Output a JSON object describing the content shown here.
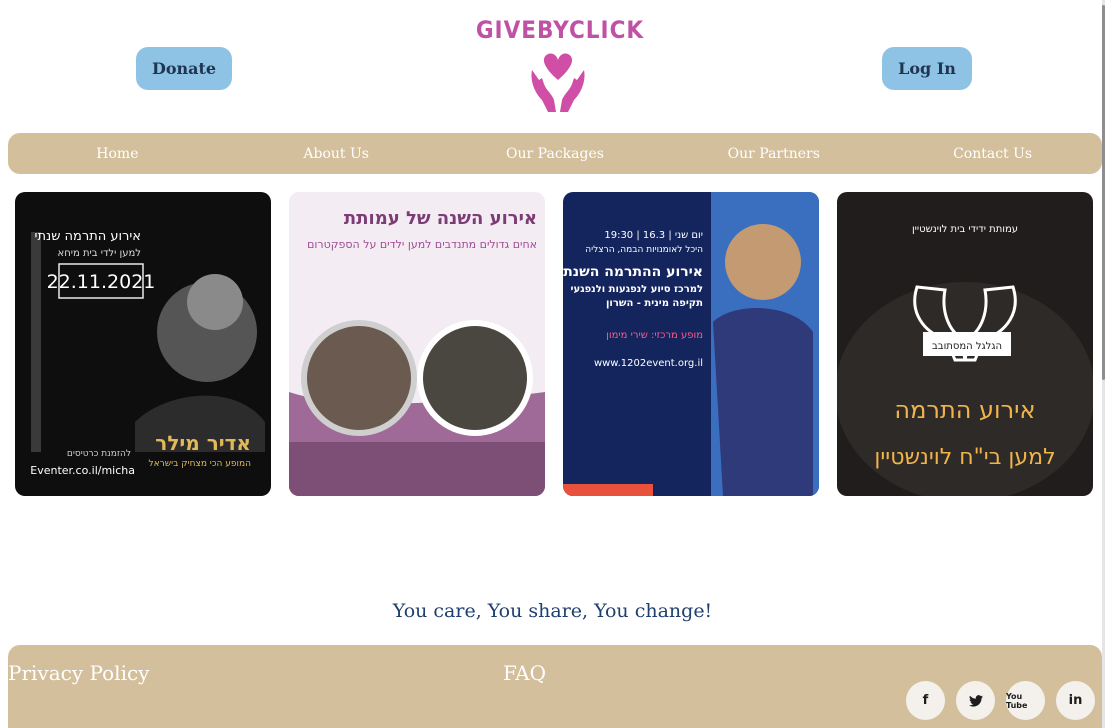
{
  "header": {
    "donate_label": "Donate",
    "login_label": "Log In",
    "logo_text": "GIVEBYCLICK"
  },
  "nav": {
    "items": [
      "Home",
      "About Us",
      "Our Packages",
      "Our Partners",
      "Contact Us"
    ]
  },
  "cards": [
    {
      "lines": [
        "אירוע התרמה שנתי",
        "למען ילדי בית מיחא",
        "22.11.2021",
        "אדיר מילר",
        "המופע הכי מצחיק בישראל",
        "Eventer.co.il/micha",
        "להזמנת כרטיסים"
      ]
    },
    {
      "lines": [
        "אירוע השנה של עמותת",
        "אחים גדולים מתנדבים למען ילדים על הספקטרום"
      ]
    },
    {
      "lines": [
        "יום שני | 16.3 | 19:30",
        "היכל לאומנויות הבמה, הרצליה",
        "אירוע ההתרמה השנתי",
        "למרכז סיוע לנפגעות ולנפגעי",
        "תקיפה מינית - השרון",
        "מופע מרכזי: שירי מימון",
        "www.1202event.org.il"
      ]
    },
    {
      "lines": [
        "עמותת ידידי בית לוינשטיין",
        "הגלגל המסתובב",
        "אירוע התרמה",
        "למען בי\"ח לוינשטיין"
      ]
    }
  ],
  "tagline": "You care, You share, You change!",
  "footer": {
    "privacy_label": "Privacy Policy",
    "faq_label": "FAQ",
    "social": [
      "f",
      "t",
      "You Tube",
      "in"
    ]
  },
  "colors": {
    "accent_tan": "#d4bf9c",
    "button_blue": "#8ec3e6",
    "logo_pink": "#c052a6"
  },
  "icons": [
    "facebook-icon",
    "twitter-icon",
    "youtube-icon",
    "linkedin-icon",
    "heart-hands-icon"
  ]
}
